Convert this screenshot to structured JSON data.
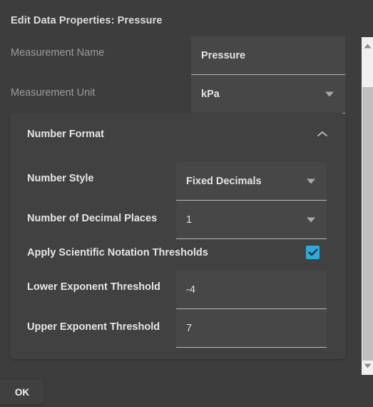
{
  "dialog": {
    "title": "Edit Data Properties: Pressure",
    "ok_label": "OK"
  },
  "fields": {
    "measurement_name": {
      "label": "Measurement Name",
      "value": "Pressure"
    },
    "measurement_unit": {
      "label": "Measurement Unit",
      "value": "kPa"
    }
  },
  "number_format": {
    "title": "Number Format",
    "expanded": true,
    "number_style": {
      "label": "Number Style",
      "value": "Fixed Decimals"
    },
    "decimal_places": {
      "label": "Number of Decimal Places",
      "value": "1"
    },
    "scientific_thresholds": {
      "label": "Apply Scientific Notation Thresholds",
      "checked": true
    },
    "lower_exponent": {
      "label": "Lower Exponent Threshold",
      "value": "-4"
    },
    "upper_exponent": {
      "label": "Upper Exponent Threshold",
      "value": "7"
    }
  },
  "icons": {
    "collapse": "chevron-up-icon",
    "dropdown": "caret-down-icon",
    "checkmark": "check-icon",
    "scroll_up": "scroll-up-arrow-icon",
    "scroll_down": "scroll-down-arrow-icon"
  },
  "colors": {
    "background": "#3d3d3d",
    "panel": "#414141",
    "field": "#474747",
    "accent": "#28abdf",
    "label_dim": "#9b9b9b",
    "label_bright": "#e6e6e6",
    "scrollbar_track": "#f0f0f0",
    "scrollbar_thumb": "#bfbfbf"
  }
}
